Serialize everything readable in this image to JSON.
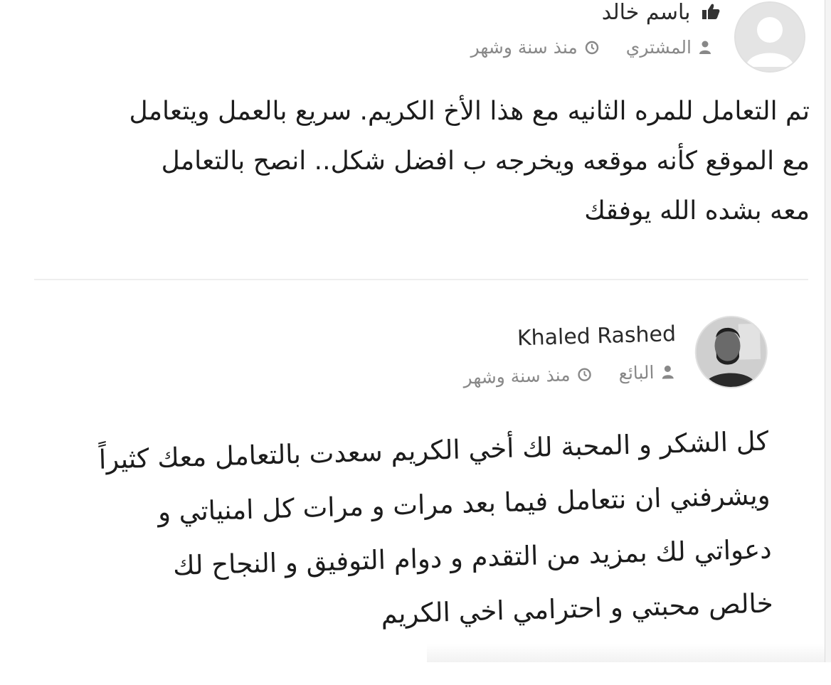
{
  "reviews": [
    {
      "author": "باسم خالد",
      "role": "المشتري",
      "time": "منذ سنة وشهر",
      "text": "تم التعامل للمره الثانيه مع هذا الأخ الكريم. سريع بالعمل ويتعامل\nمع الموقع كأنه موقعه ويخرجه ب افضل شكل.. انصح بالتعامل\nمعه بشده الله يوفقك",
      "icons": {
        "author": "thumbs-up-icon",
        "role": "user-icon",
        "time": "clock-icon",
        "avatar": "default-avatar"
      }
    },
    {
      "author": "Khaled Rashed",
      "role": "البائع",
      "time": "منذ سنة وشهر",
      "text": "كل الشكر و المحبة لك أخي الكريم سعدت بالتعامل معك كثيراً\nويشرفني ان نتعامل فيما بعد مرات و مرات كل امنياتي و\nدعواتي لك بمزيد من التقدم و دوام التوفيق و النجاح لك\nخالص محبتي و احترامي اخي الكريم",
      "icons": {
        "role": "user-icon",
        "time": "clock-icon",
        "avatar": "profile-photo"
      }
    }
  ],
  "colors": {
    "text": "#1c1c1c",
    "meta": "#888888",
    "divider": "#eeeeee"
  }
}
